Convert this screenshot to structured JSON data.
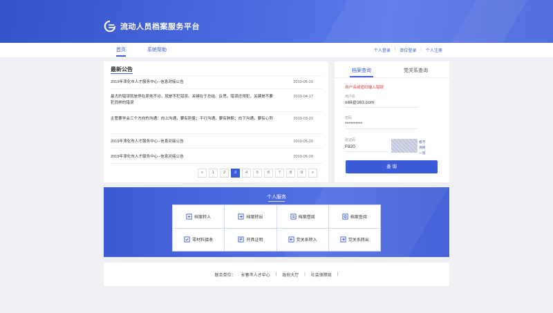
{
  "header": {
    "title": "流动人员档案服务平台"
  },
  "nav": {
    "tabs": [
      {
        "label": "首页"
      },
      {
        "label": "系统帮助"
      }
    ],
    "right": [
      {
        "label": "个人登录"
      },
      {
        "label": "单位登录"
      },
      {
        "label": "个人注册"
      }
    ],
    "sep": "|"
  },
  "notice": {
    "title": "最新公告",
    "items": [
      {
        "text": "2019年漳化市人才服务中心--信息对接公告",
        "date": "2019-05-20"
      },
      {
        "text": "最大的错误就是停在原地不动，就是不犯错误。关键在于总结、反思。错误还得犯，关键是不要犯同样的错误",
        "date": "2019-04-17"
      },
      {
        "text": "主管要学会三个方向的沟通：向上沟通，要有胆量；平行沟通，要有肺腑；向下沟通，要有心肝",
        "date": "2019-03-22"
      },
      {
        "text": "2019年漳化市人才服务中心--信息对接公告",
        "date": "2019-05-20"
      },
      {
        "text": "2019年漳化市人才服务中心--信息对接公告",
        "date": "2019-05-20"
      }
    ],
    "pager": {
      "prev": "<",
      "next": ">",
      "pages": [
        "1",
        "2",
        "3",
        "4",
        "5",
        "6",
        "7",
        "8",
        "9"
      ],
      "current": "3"
    }
  },
  "query": {
    "tabs": [
      {
        "label": "档案查询"
      },
      {
        "label": "党关系查询"
      }
    ],
    "error": "用户名或密码输入错误",
    "username": {
      "label": "用户名",
      "value": "xilili@163.com"
    },
    "password": {
      "label": "密码",
      "value": "**********"
    },
    "captcha": {
      "label": "验证码",
      "value": "F920",
      "refresh": "看不清换一张"
    },
    "button": "查 询"
  },
  "services": {
    "title": "个人服务",
    "items": [
      {
        "label": "档案转入",
        "icon": "doc-import-icon"
      },
      {
        "label": "档案转出",
        "icon": "doc-export-icon"
      },
      {
        "label": "档案借阅",
        "icon": "doc-borrow-icon"
      },
      {
        "label": "档案查阅",
        "icon": "doc-view-icon"
      },
      {
        "label": "零材料接收",
        "icon": "material-receive-icon"
      },
      {
        "label": "开具证明",
        "icon": "certificate-icon"
      },
      {
        "label": "党关系转入",
        "icon": "party-import-icon"
      },
      {
        "label": "党关系转出",
        "icon": "party-export-icon"
      }
    ]
  },
  "footer": {
    "label": "联合单位：",
    "links": [
      {
        "label": "长春市人才中心"
      },
      {
        "label": "政府大厅"
      },
      {
        "label": "社会保障局"
      }
    ],
    "sep": "|"
  },
  "colors": {
    "primary": "#3b5bd9",
    "error": "#e53935",
    "background": "#eef0f3"
  }
}
